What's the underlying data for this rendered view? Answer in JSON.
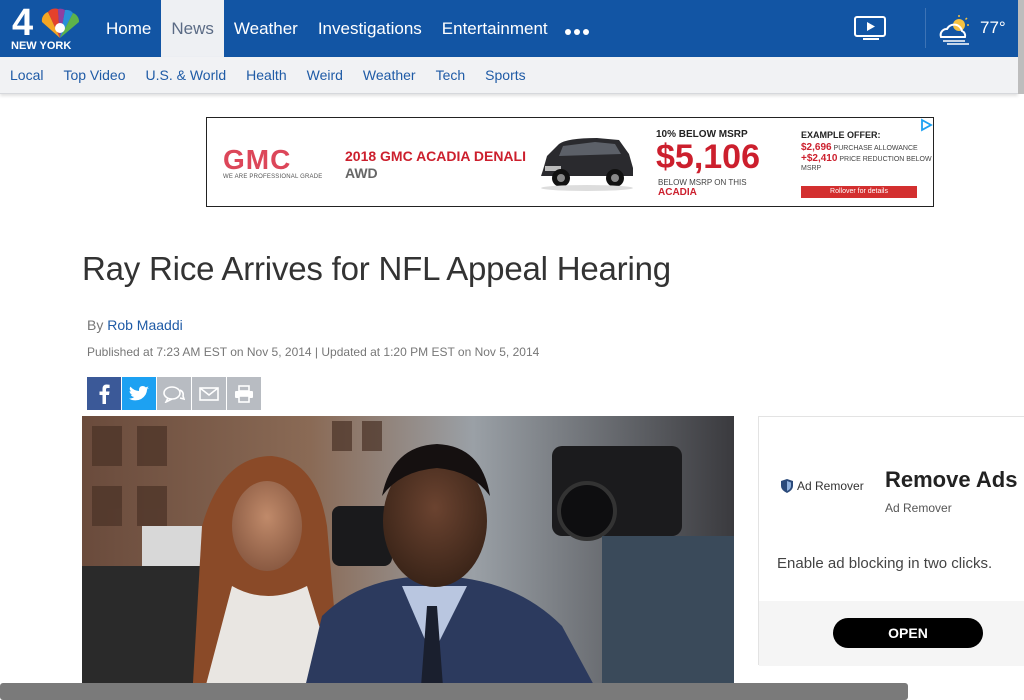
{
  "header": {
    "logo_number": "4",
    "logo_city": "NEW YORK",
    "main_nav": [
      {
        "label": "Home",
        "active": false
      },
      {
        "label": "News",
        "active": true
      },
      {
        "label": "Weather",
        "active": false
      },
      {
        "label": "Investigations",
        "active": false
      },
      {
        "label": "Entertainment",
        "active": false
      }
    ],
    "more_icon": "more-dots-icon",
    "video_icon": "video-play-icon",
    "weather_icon": "partly-cloudy-icon",
    "temperature": "77°"
  },
  "sub_nav": [
    "Local",
    "Top Video",
    "U.S. & World",
    "Health",
    "Weird",
    "Weather",
    "Tech",
    "Sports"
  ],
  "ad_banner": {
    "brand": "GMC",
    "brand_tagline": "WE ARE PROFESSIONAL GRADE",
    "model": "2018 GMC ACADIA DENALI",
    "trim": "AWD",
    "discount_label": "10% BELOW MSRP",
    "price": "$5,106",
    "price_note": "BELOW MSRP ON THIS",
    "price_model": "ACADIA",
    "offer_header": "EXAMPLE OFFER:",
    "offer_line1_amount": "$2,696",
    "offer_line1_text": "PURCHASE ALLOWANCE",
    "offer_line2_amount": "+$2,410",
    "offer_line2_text": "PRICE REDUCTION BELOW",
    "offer_line3_text": "MSRP",
    "offer_button": "Rollover for details"
  },
  "article": {
    "headline": "Ray Rice Arrives for NFL Appeal Hearing",
    "byline_prefix": "By ",
    "author": "Rob Maaddi",
    "published": "Published at 7:23 AM EST on Nov 5, 2014 | Updated at 1:20 PM EST on Nov 5, 2014"
  },
  "share_icons": [
    "facebook-icon",
    "twitter-icon",
    "comment-icon",
    "email-icon",
    "print-icon"
  ],
  "side_ad": {
    "brand": "Ad Remover",
    "title": "Remove Ads",
    "subtitle": "Ad Remover",
    "description": "Enable ad blocking in two clicks.",
    "button": "OPEN"
  },
  "colors": {
    "nav_blue": "#1255a4",
    "link_blue": "#1f5ba6",
    "gmc_red": "#cc1f2d",
    "facebook": "#3b5998",
    "twitter": "#1da1f2"
  }
}
